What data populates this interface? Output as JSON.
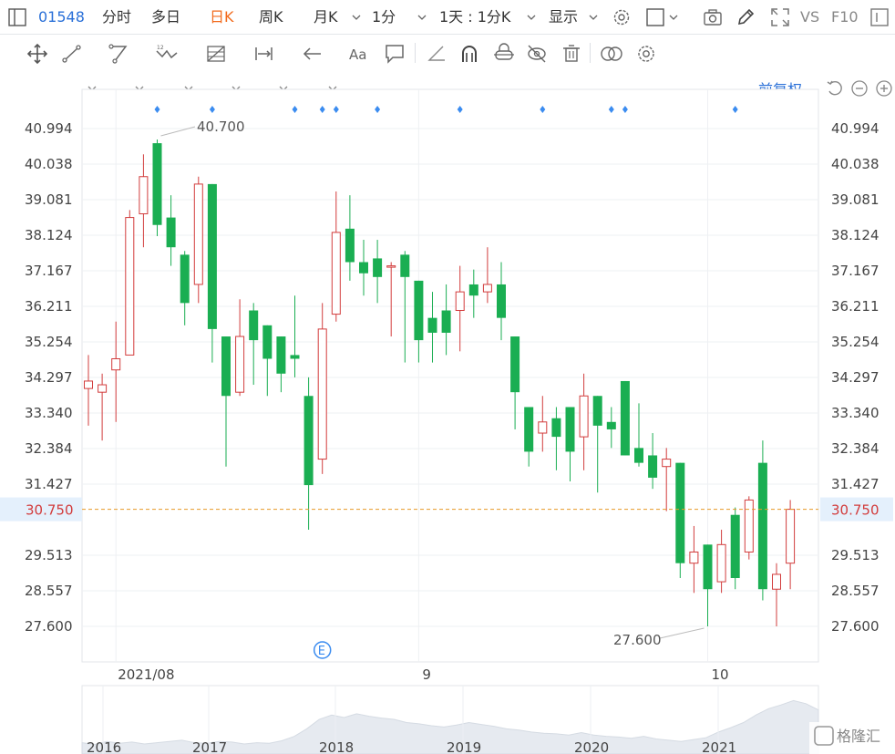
{
  "topbar": {
    "code": "01548",
    "tabs": [
      "分时",
      "多日",
      "日K",
      "周K",
      "月K"
    ],
    "active_tab": "日K",
    "interval": "1分",
    "multi": "1天 : 1分K",
    "display": "显示",
    "vs": "VS",
    "f10": "F10"
  },
  "chart_controls": {
    "restore_label": "前复权"
  },
  "colors": {
    "up": "#d23c3c",
    "down": "#1aae52",
    "grid": "#eef0f3",
    "current_line": "#e89a27",
    "marker": "#3b8cf0",
    "accent": "#2a70d8"
  },
  "chart_data": {
    "type": "candlestick",
    "y_axis": {
      "min": 27.6,
      "max": 40.994,
      "ticks": [
        "40.994",
        "40.038",
        "39.081",
        "38.124",
        "37.167",
        "36.211",
        "35.254",
        "34.297",
        "33.340",
        "32.384",
        "31.427",
        "29.513",
        "28.557",
        "27.600"
      ]
    },
    "x_labels": [
      {
        "label": "2021/08",
        "index": 2
      },
      {
        "label": "9",
        "index": 24
      },
      {
        "label": "10",
        "index": 45
      }
    ],
    "current_price": "30.750",
    "high_label": {
      "text": "40.700",
      "index": 5
    },
    "low_label": {
      "text": "27.600",
      "index": 45
    },
    "event_marker": {
      "text": "E",
      "index": 17
    },
    "marker_indices": [
      5,
      9,
      15,
      17,
      18,
      21,
      27,
      33,
      38,
      39,
      47
    ],
    "candles": [
      {
        "o": 34.0,
        "h": 34.9,
        "l": 33.0,
        "c": 34.2
      },
      {
        "o": 33.9,
        "h": 34.4,
        "l": 32.6,
        "c": 34.1
      },
      {
        "o": 34.5,
        "h": 35.8,
        "l": 33.1,
        "c": 34.8
      },
      {
        "o": 34.9,
        "h": 38.8,
        "l": 34.9,
        "c": 38.6
      },
      {
        "o": 38.7,
        "h": 40.3,
        "l": 37.8,
        "c": 39.7
      },
      {
        "o": 40.6,
        "h": 40.7,
        "l": 38.1,
        "c": 38.4
      },
      {
        "o": 38.6,
        "h": 39.2,
        "l": 37.3,
        "c": 37.8
      },
      {
        "o": 37.6,
        "h": 37.7,
        "l": 35.7,
        "c": 36.3
      },
      {
        "o": 36.8,
        "h": 39.7,
        "l": 36.3,
        "c": 39.5
      },
      {
        "o": 39.5,
        "h": 39.5,
        "l": 34.7,
        "c": 35.6
      },
      {
        "o": 35.4,
        "h": 35.4,
        "l": 31.9,
        "c": 33.8
      },
      {
        "o": 33.9,
        "h": 36.4,
        "l": 33.8,
        "c": 35.4
      },
      {
        "o": 36.1,
        "h": 36.3,
        "l": 34.1,
        "c": 35.3
      },
      {
        "o": 35.7,
        "h": 35.7,
        "l": 33.8,
        "c": 34.8
      },
      {
        "o": 35.4,
        "h": 35.4,
        "l": 33.9,
        "c": 34.4
      },
      {
        "o": 34.9,
        "h": 36.5,
        "l": 34.3,
        "c": 34.8
      },
      {
        "o": 33.8,
        "h": 34.3,
        "l": 30.2,
        "c": 31.4
      },
      {
        "o": 32.1,
        "h": 36.3,
        "l": 31.7,
        "c": 35.6
      },
      {
        "o": 36.0,
        "h": 39.3,
        "l": 35.8,
        "c": 38.2
      },
      {
        "o": 38.3,
        "h": 39.2,
        "l": 36.9,
        "c": 37.4
      },
      {
        "o": 37.4,
        "h": 38.0,
        "l": 36.5,
        "c": 37.1
      },
      {
        "o": 37.5,
        "h": 38.0,
        "l": 36.3,
        "c": 37.0
      },
      {
        "o": 37.3,
        "h": 37.4,
        "l": 35.4,
        "c": 37.3
      },
      {
        "o": 37.6,
        "h": 37.7,
        "l": 34.7,
        "c": 37.0
      },
      {
        "o": 36.9,
        "h": 36.9,
        "l": 34.7,
        "c": 35.3
      },
      {
        "o": 35.9,
        "h": 36.6,
        "l": 34.7,
        "c": 35.5
      },
      {
        "o": 36.1,
        "h": 36.8,
        "l": 34.9,
        "c": 35.5
      },
      {
        "o": 36.1,
        "h": 37.3,
        "l": 35.0,
        "c": 36.6
      },
      {
        "o": 36.8,
        "h": 37.2,
        "l": 35.9,
        "c": 36.5
      },
      {
        "o": 36.6,
        "h": 37.8,
        "l": 36.3,
        "c": 36.8
      },
      {
        "o": 36.8,
        "h": 37.4,
        "l": 35.3,
        "c": 35.9
      },
      {
        "o": 35.4,
        "h": 35.4,
        "l": 32.9,
        "c": 33.9
      },
      {
        "o": 33.5,
        "h": 33.5,
        "l": 31.9,
        "c": 32.3
      },
      {
        "o": 32.8,
        "h": 33.8,
        "l": 32.3,
        "c": 33.1
      },
      {
        "o": 33.2,
        "h": 33.5,
        "l": 31.8,
        "c": 32.7
      },
      {
        "o": 33.5,
        "h": 33.5,
        "l": 31.5,
        "c": 32.3
      },
      {
        "o": 32.7,
        "h": 34.4,
        "l": 31.8,
        "c": 33.8
      },
      {
        "o": 33.8,
        "h": 33.8,
        "l": 31.2,
        "c": 33.0
      },
      {
        "o": 33.1,
        "h": 33.5,
        "l": 32.4,
        "c": 32.9
      },
      {
        "o": 34.2,
        "h": 34.2,
        "l": 32.2,
        "c": 32.2
      },
      {
        "o": 32.4,
        "h": 33.6,
        "l": 31.9,
        "c": 32.0
      },
      {
        "o": 32.2,
        "h": 32.8,
        "l": 31.3,
        "c": 31.6
      },
      {
        "o": 31.9,
        "h": 32.4,
        "l": 30.7,
        "c": 32.1
      },
      {
        "o": 32.0,
        "h": 32.0,
        "l": 28.9,
        "c": 29.3
      },
      {
        "o": 29.3,
        "h": 30.3,
        "l": 28.5,
        "c": 29.6
      },
      {
        "o": 29.8,
        "h": 29.8,
        "l": 27.6,
        "c": 28.6
      },
      {
        "o": 28.8,
        "h": 30.2,
        "l": 28.5,
        "c": 29.8
      },
      {
        "o": 30.6,
        "h": 30.8,
        "l": 28.6,
        "c": 28.9
      },
      {
        "o": 29.6,
        "h": 31.1,
        "l": 29.4,
        "c": 31.0
      },
      {
        "o": 32.0,
        "h": 32.6,
        "l": 28.3,
        "c": 28.6
      },
      {
        "o": 28.6,
        "h": 29.3,
        "l": 27.6,
        "c": 29.0
      },
      {
        "o": 29.3,
        "h": 31.0,
        "l": 28.6,
        "c": 30.75
      }
    ]
  },
  "navigator": {
    "years": [
      "2016",
      "2017",
      "2018",
      "2019",
      "2020",
      "2021"
    ],
    "profile": [
      0.18,
      0.15,
      0.2,
      0.17,
      0.19,
      0.16,
      0.18,
      0.2,
      0.22,
      0.18,
      0.17,
      0.2,
      0.19,
      0.16,
      0.18,
      0.17,
      0.21,
      0.28,
      0.4,
      0.55,
      0.62,
      0.58,
      0.64,
      0.6,
      0.57,
      0.55,
      0.5,
      0.48,
      0.45,
      0.43,
      0.46,
      0.5,
      0.47,
      0.44,
      0.4,
      0.38,
      0.35,
      0.33,
      0.32,
      0.3,
      0.34,
      0.3,
      0.28,
      0.27,
      0.25,
      0.28,
      0.24,
      0.22,
      0.2,
      0.23,
      0.26,
      0.35,
      0.42,
      0.5,
      0.62,
      0.72,
      0.78,
      0.85,
      0.8,
      0.7
    ]
  },
  "branding": {
    "logo_text": "格隆汇"
  }
}
